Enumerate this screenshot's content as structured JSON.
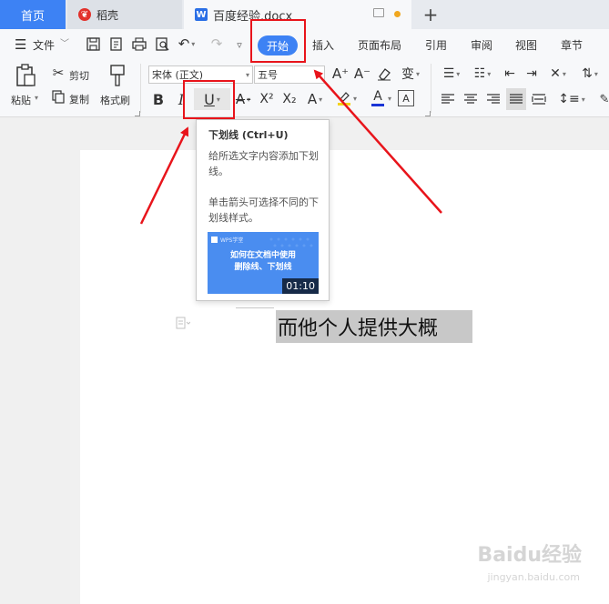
{
  "tabs": {
    "home": "首页",
    "daoke": "稻壳",
    "document": "百度经验.docx"
  },
  "menu": {
    "file": "文件",
    "items": [
      "插入",
      "页面布局",
      "引用",
      "审阅",
      "视图",
      "章节"
    ],
    "active": "开始"
  },
  "ribbon": {
    "paste": "粘贴",
    "cut": "剪切",
    "copy": "复制",
    "format_painter": "格式刷",
    "font_name": "宋体 (正文)",
    "font_size": "五号",
    "bold": "B",
    "italic": "I",
    "underline": "U",
    "strike": "A",
    "superscript": "X²",
    "subscript": "X₂",
    "text_effect": "A",
    "font_color": "A",
    "char_border": "A",
    "grow": "A⁺",
    "shrink": "A⁻"
  },
  "tooltip": {
    "title": "下划线 (Ctrl+U)",
    "description": "给所选文字内容添加下划线。",
    "hint": "单击箭头可选择不同的下划线样式。",
    "video_brand": "WPS学堂",
    "video_title_1": "如何在文档中使用",
    "video_title_2": "删除线、下划线",
    "video_duration": "01:10"
  },
  "document": {
    "selected_text": "而他个人提供大概"
  },
  "watermark": {
    "brand": "Baidu经验",
    "url": "jingyan.baidu.com"
  },
  "colors": {
    "accent": "#3d82f4",
    "annotation": "#e8141b",
    "font_color_bar": "#1a35d6",
    "highlight_bar": "#f5d31a"
  }
}
